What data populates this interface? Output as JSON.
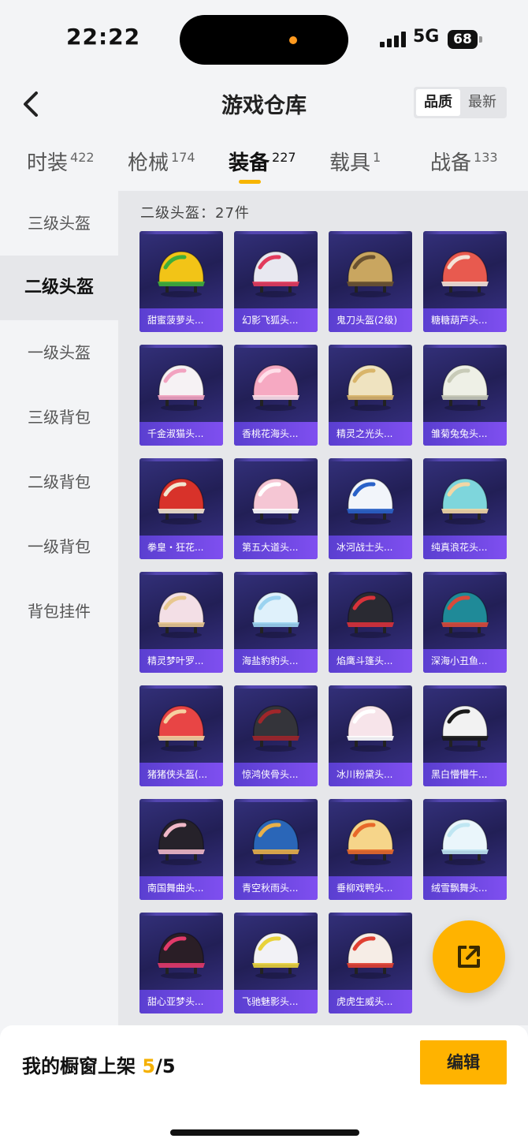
{
  "status_bar": {
    "time": "22:22",
    "network": "5G",
    "battery": "68"
  },
  "header": {
    "title": "游戏仓库",
    "sort_options": [
      "品质",
      "最新"
    ],
    "active_sort": "品质"
  },
  "tabs": [
    {
      "label": "时装",
      "count": "422"
    },
    {
      "label": "枪械",
      "count": "174"
    },
    {
      "label": "装备",
      "count": "227"
    },
    {
      "label": "载具",
      "count": "1"
    },
    {
      "label": "战备",
      "count": "133"
    }
  ],
  "active_tab": "装备",
  "sidebar": {
    "items": [
      "三级头盔",
      "二级头盔",
      "一级头盔",
      "三级背包",
      "二级背包",
      "一级背包",
      "背包挂件"
    ],
    "active": "二级头盔"
  },
  "content": {
    "count_label": "二级头盔：27件",
    "items": [
      {
        "name": "甜蜜菠萝头...",
        "color": "#f2c417",
        "accent": "#3fae3a"
      },
      {
        "name": "幻影飞狐头...",
        "color": "#e8e8f0",
        "accent": "#e23b5c"
      },
      {
        "name": "鬼刀头盔(2级)",
        "color": "#c9a660",
        "accent": "#6a5230"
      },
      {
        "name": "糖糖葫芦头...",
        "color": "#e85a4f",
        "accent": "#f4e3d8"
      },
      {
        "name": "千金淑猫头...",
        "color": "#f6f2f4",
        "accent": "#f2a3c0"
      },
      {
        "name": "香桃花海头...",
        "color": "#f6a9c2",
        "accent": "#ffe0ea"
      },
      {
        "name": "精灵之光头...",
        "color": "#efe3c0",
        "accent": "#d9b56a"
      },
      {
        "name": "雏菊兔兔头...",
        "color": "#eef0e6",
        "accent": "#c8cbb8"
      },
      {
        "name": "拳皇・狂花...",
        "color": "#d8322a",
        "accent": "#f2e6d0"
      },
      {
        "name": "第五大道头...",
        "color": "#f5c6d4",
        "accent": "#ffffff"
      },
      {
        "name": "冰河战士头...",
        "color": "#f2f5fa",
        "accent": "#2a62c8"
      },
      {
        "name": "纯真浪花头...",
        "color": "#7ed6dc",
        "accent": "#f3d7a5"
      },
      {
        "name": "精灵梦叶罗...",
        "color": "#f3dfe6",
        "accent": "#e8c78f"
      },
      {
        "name": "海盐豹豹头...",
        "color": "#dff1fb",
        "accent": "#9bd3f0"
      },
      {
        "name": "焰鹰斗篷头...",
        "color": "#2a2a32",
        "accent": "#d8323a"
      },
      {
        "name": "深海小丑鱼...",
        "color": "#1f8a98",
        "accent": "#d84a3a"
      },
      {
        "name": "猪猪侠头盔(...",
        "color": "#e84545",
        "accent": "#f6d0a0"
      },
      {
        "name": "惊鸿侠骨头...",
        "color": "#34343a",
        "accent": "#a0262a"
      },
      {
        "name": "冰川粉黛头...",
        "color": "#f7e4ea",
        "accent": "#ffffff"
      },
      {
        "name": "黑白懵懵牛...",
        "color": "#f2f2f2",
        "accent": "#1a1a1a"
      },
      {
        "name": "南国舞曲头...",
        "color": "#26222a",
        "accent": "#f0b8c8"
      },
      {
        "name": "青空秋雨头...",
        "color": "#2a66b8",
        "accent": "#e8b04a"
      },
      {
        "name": "垂柳戏鸭头...",
        "color": "#f6d58a",
        "accent": "#e8692a"
      },
      {
        "name": "绒雪飘舞头...",
        "color": "#eaf6fb",
        "accent": "#bfe6f2"
      },
      {
        "name": "甜心亚梦头...",
        "color": "#2a1e26",
        "accent": "#e23a6a"
      },
      {
        "name": "飞驰魅影头...",
        "color": "#f2f2f6",
        "accent": "#e8d23a"
      },
      {
        "name": "虎虎生威头...",
        "color": "#f6ede6",
        "accent": "#e04032"
      }
    ]
  },
  "fab": {
    "icon": "share-external-icon"
  },
  "footer": {
    "label": "我的橱窗上架",
    "current": "5",
    "separator": "/",
    "max": "5",
    "edit_label": "编辑"
  }
}
